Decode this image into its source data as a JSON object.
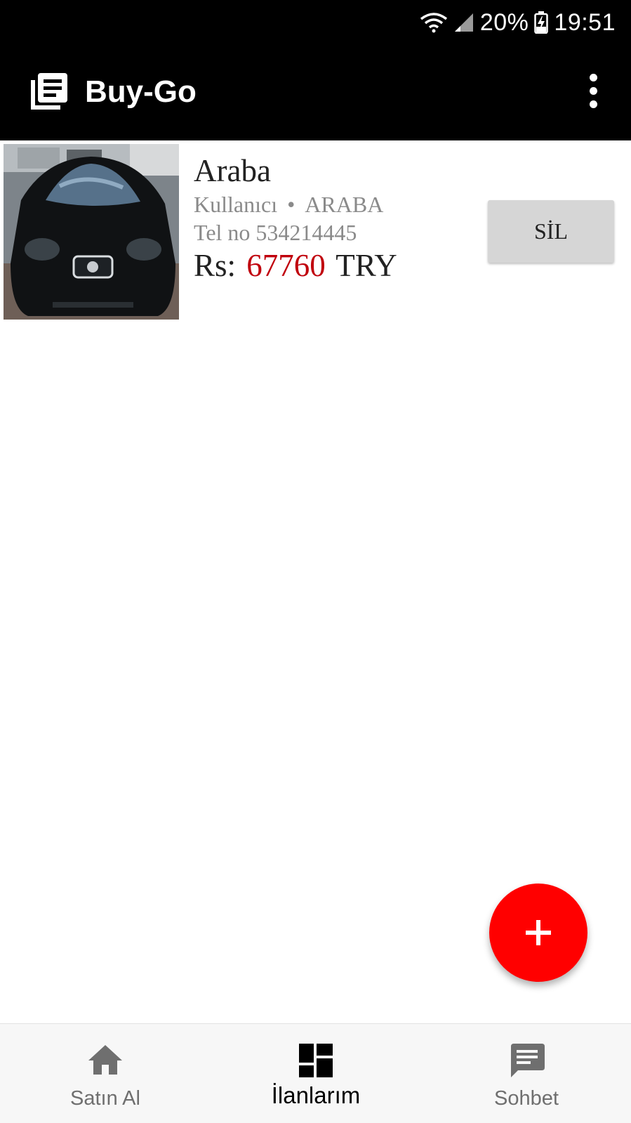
{
  "status_bar": {
    "battery": "20%",
    "time": "19:51",
    "icons": [
      "wifi-icon",
      "signal-icon",
      "battery-charging-icon"
    ]
  },
  "app_bar": {
    "title": "Buy-Go",
    "icon": "news-list-icon",
    "menu_icon": "more-vert-icon"
  },
  "listing": {
    "title": "Araba",
    "user": "Kullanıcı",
    "separator": "•",
    "category": "ARABA",
    "phone": "Tel no 534214445",
    "price_prefix": "Rs:",
    "price": "67760",
    "currency": "TRY",
    "delete_label": "SİL",
    "photo": "car-photo"
  },
  "fab": {
    "icon": "plus-icon"
  },
  "bottom_nav": {
    "items": [
      {
        "label": "Satın Al",
        "icon": "home-icon",
        "active": false
      },
      {
        "label": "İlanlarım",
        "icon": "dashboard-icon",
        "active": true
      },
      {
        "label": "Sohbet",
        "icon": "chat-icon",
        "active": false
      }
    ]
  },
  "colors": {
    "bar_background": "#000000",
    "price_accent": "#c0000c",
    "fab": "#ff0000",
    "nav_background": "#f7f7f7"
  }
}
